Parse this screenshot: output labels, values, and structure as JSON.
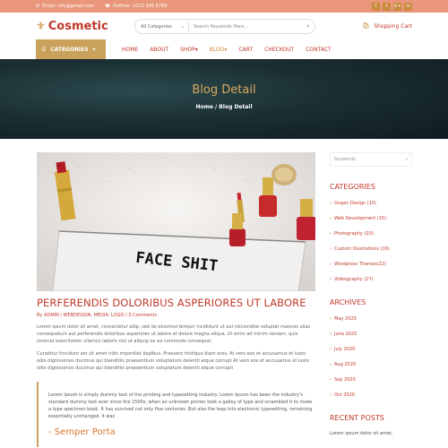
{
  "topbar": {
    "email": "Email: info@gmail.com",
    "hotline": "Hotline: +012 345 6789",
    "socials": [
      "f",
      "t",
      "G+",
      "in"
    ]
  },
  "brand": {
    "name": "Cosmetic"
  },
  "search": {
    "category": "All Categories",
    "placeholder": "Search Keywords Here..."
  },
  "cart": {
    "label": "Shopping Cart"
  },
  "nav": {
    "categories_label": "CATEGORIES",
    "items": [
      "HOME",
      "ABOUT",
      "SHOP",
      "BLOG",
      "CART",
      "CHECKOUT",
      "CONTACT"
    ]
  },
  "hero": {
    "title": "Blog Detail",
    "crumb_home": "Home",
    "crumb_current": "/ Blog Detail"
  },
  "post": {
    "title": "PERFERENDIS DOLORIBUS ASPERIORES UT LABORE",
    "meta": "By ADMIN / WEBDESIGN, MEDIA, LOGO / 3 Comments",
    "photo_text": "FACE SHIT",
    "para1": "Lorem ipsum dolor sit amet, consectetur adip, sed do eiusmod tempor incididunt ut aut reiciendise voluptat maiores alias consequaturs aut perferendis doloribus asperiores ut labore et dolore magna aliqua. Ut enim ad minim veniam, quis nostrud exercitation ullamco laboris nisi ut aliquip ex ea commodo consequat.",
    "para2": "Curabitur tincidunt est sit amet nibh imperdiet dapibus. Praesent tristique diam eros, At vero eos et accusamus et iusto odio dignissimos ducimus qui blanditiis praesentium voluptatum deleniti atque corrupt At vero eos et accusamus et iusto odio dignissimos ducimus qui blanditiis praesentium voluptatum deleniti atque corrupti",
    "quote": "Lorem Ipsum is simply dummy text of the printing and typesetting industry. Lorem Ipsum has been the industry's standard dummy text ever since the 1500s, when an unknown printer took a galley of type and scrambled it to make a type specimen book. It has survived not only five centuries. But also the leap into electronic typesetting, remaining essentially unchanged. It was",
    "quote_author": "- Semper Porta"
  },
  "sidebar": {
    "search_placeholder": "Keywords",
    "categories_title": "CATEGORIES",
    "categories": [
      "Grapic Design (10)",
      "Web Development (15)",
      "Photography (20)",
      "Custom Illustrations (16)",
      "Wordpress Themes(22)",
      "Videography (27)"
    ],
    "archives_title": "ARCHIVES",
    "archives": [
      "May 2020",
      "June 2020",
      "July 2020",
      "Aug 2020",
      "Sep 2020",
      "Oct 2020"
    ],
    "recent_title": "RECENT POSTS",
    "recent_first": "Lorem ipsum dolor sit amet,"
  },
  "colors": {
    "accent": "#c0392b",
    "gold": "#c9a15b",
    "topbar": "#e9967a"
  }
}
